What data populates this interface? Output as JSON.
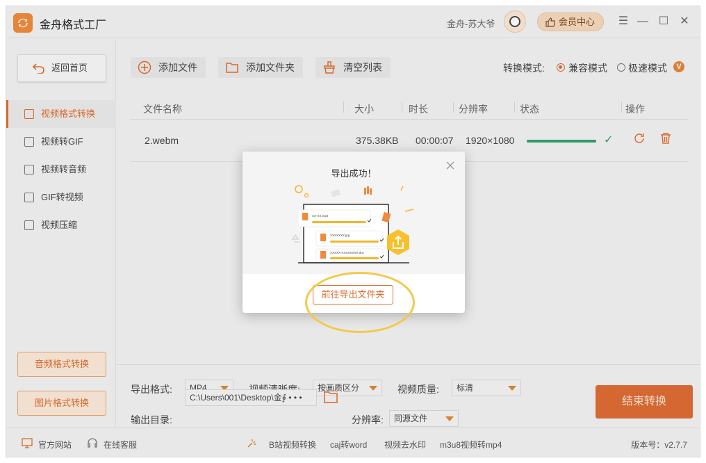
{
  "app": {
    "title": "金舟格式工厂",
    "user_name": "金舟-苏大爷",
    "member_label": "会员中心"
  },
  "sidebar": {
    "home_label": "返回首页",
    "items": [
      {
        "label": "视频格式转换",
        "icon": "play-file-icon"
      },
      {
        "label": "视频转GIF",
        "icon": "image-icon"
      },
      {
        "label": "视频转音频",
        "icon": "music-icon"
      },
      {
        "label": "GIF转视频",
        "icon": "play-file-icon"
      },
      {
        "label": "视频压缩",
        "icon": "compress-icon"
      }
    ],
    "audio_convert_label": "音频格式转换",
    "image_convert_label": "图片格式转换"
  },
  "toolbar": {
    "add_file_label": "添加文件",
    "add_folder_label": "添加文件夹",
    "clear_list_label": "清空列表",
    "mode_label": "转换模式:",
    "mode_compatible": "兼容模式",
    "mode_fast": "极速模式",
    "vip_badge": "V",
    "selected_mode": "兼容模式"
  },
  "table": {
    "columns": [
      "文件名称",
      "大小",
      "时长",
      "分辨率",
      "状态",
      "操作"
    ],
    "rows": [
      {
        "name": "2.webm",
        "size": "375.38KB",
        "duration": "00:00:07",
        "resolution": "1920×1080",
        "progress": 1.0
      }
    ]
  },
  "bottom": {
    "format_label": "导出格式:",
    "format_value": "MP4",
    "clarity_label": "视频清晰度:",
    "clarity_value": "按画质区分",
    "quality_label": "视频质量:",
    "quality_value": "标清",
    "output_label": "输出目录:",
    "output_path": "C:\\Users\\001\\Desktop\\金∮ • • •",
    "resolution_label": "分辨率:",
    "resolution_value": "同源文件",
    "end_button": "结束转换"
  },
  "statusbar": {
    "official_site": "官方网站",
    "online_service": "在线客服",
    "links": [
      "B站视频转换",
      "caj转word",
      "视频去水印",
      "m3u8视频转mp4"
    ],
    "version": "版本号：v2.7.7"
  },
  "dialog": {
    "title": "导出成功！",
    "open_folder_button": "前往导出文件夹",
    "illus_files": [
      "XX-XX.mp4",
      "XXXXXXX.jpg",
      "XXXXX-XXXXXXXX.doc"
    ]
  },
  "colors": {
    "accent": "#e06d2b",
    "success": "#2fa36b",
    "highlight": "#f2c94c"
  }
}
